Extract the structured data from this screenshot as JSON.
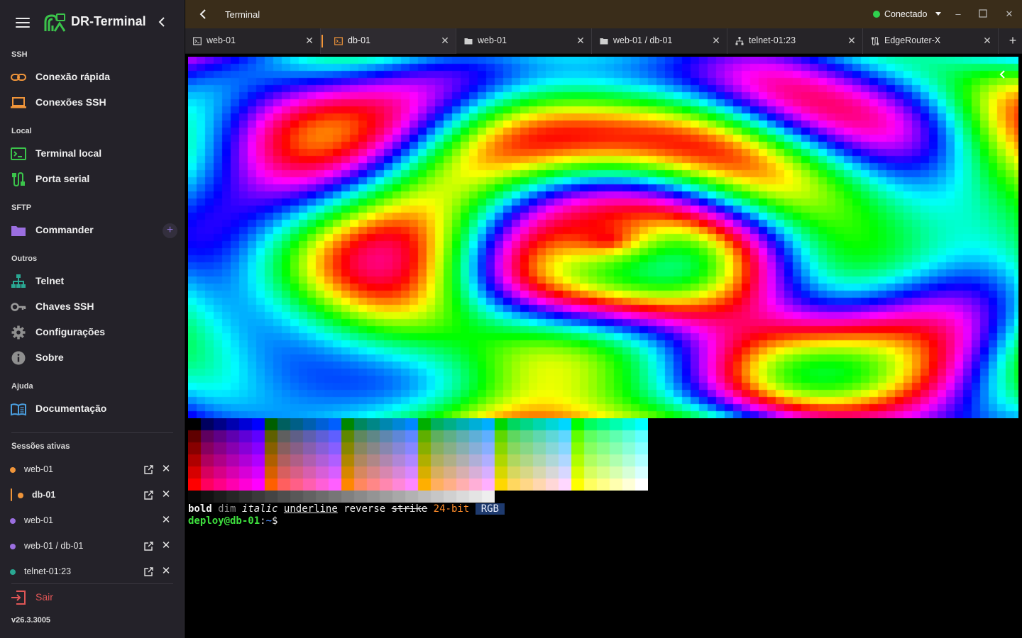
{
  "app": {
    "title": "DR-Terminal",
    "version": "v26.3.3005"
  },
  "sidebar": {
    "sections": {
      "ssh": "SSH",
      "local": "Local",
      "sftp": "SFTP",
      "outros": "Outros",
      "ajuda": "Ajuda",
      "sessions": "Sessões ativas"
    },
    "items": {
      "quick": {
        "label": "Conexão rápida",
        "icon": "link-icon"
      },
      "ssh_conns": {
        "label": "Conexões SSH",
        "icon": "laptop-icon"
      },
      "local_term": {
        "label": "Terminal local",
        "icon": "terminal-icon"
      },
      "serial": {
        "label": "Porta serial",
        "icon": "serial-plug-icon"
      },
      "commander": {
        "label": "Commander",
        "icon": "folder-icon"
      },
      "telnet": {
        "label": "Telnet",
        "icon": "network-icon"
      },
      "keys": {
        "label": "Chaves SSH",
        "icon": "key-icon"
      },
      "settings": {
        "label": "Configurações",
        "icon": "gear-icon"
      },
      "about": {
        "label": "Sobre",
        "icon": "info-icon"
      },
      "docs": {
        "label": "Documentação",
        "icon": "book-icon"
      }
    },
    "sessions": [
      {
        "name": "web-01",
        "color": "#f0953a"
      },
      {
        "name": "db-01",
        "color": "#f0953a"
      },
      {
        "name": "web-01",
        "color": "#9b6fe0"
      },
      {
        "name": "web-01 / db-01",
        "color": "#9b6fe0"
      },
      {
        "name": "telnet-01:23",
        "color": "#2aa893"
      }
    ],
    "logout": "Sair"
  },
  "titlebar": {
    "title": "Terminal",
    "status": "Conectado",
    "status_color": "#2fd14e"
  },
  "tabs": [
    {
      "label": "web-01",
      "icon": "terminal-icon"
    },
    {
      "label": "db-01",
      "icon": "terminal-icon"
    },
    {
      "label": "web-01",
      "icon": "folder-icon"
    },
    {
      "label": "web-01 / db-01",
      "icon": "folder-icon"
    },
    {
      "label": "telnet-01:23",
      "icon": "network-icon"
    },
    {
      "label": "EdgeRouter-X",
      "icon": "serial-plug-icon"
    }
  ],
  "terminal": {
    "styles": {
      "bold": "bold",
      "dim": "dim",
      "italic": "italic",
      "underline": "underline",
      "reverse": "reverse",
      "strike": "strike",
      "truecolor": "24-bit",
      "rgb": "RGB"
    },
    "prompt": {
      "user": "deploy@db-01",
      "sep": ":",
      "path": "~",
      "sym": "$"
    }
  },
  "colors": {
    "accent": "#f0953a",
    "purple": "#9b6fe0",
    "teal": "#2aa893",
    "danger": "#e05656"
  }
}
